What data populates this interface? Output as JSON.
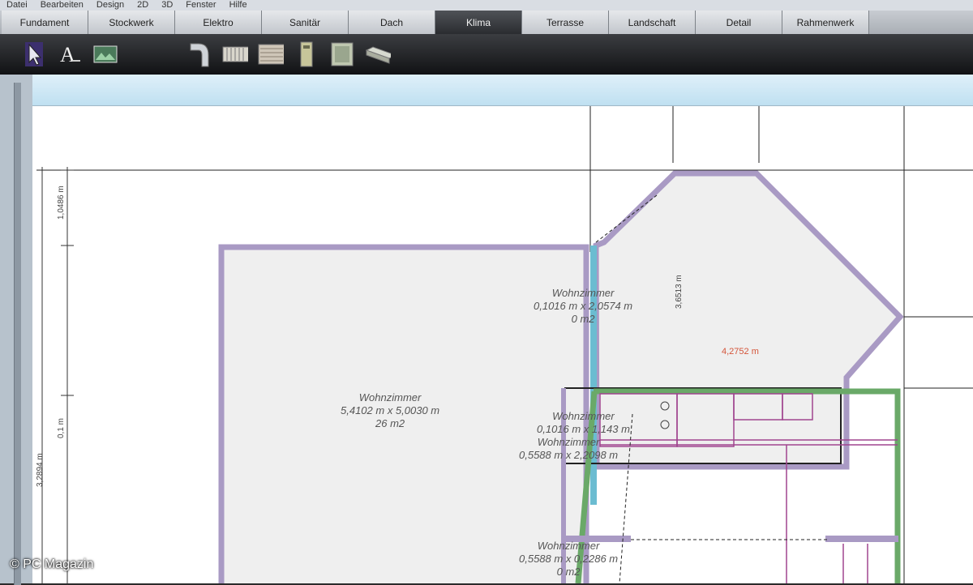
{
  "menu": [
    "Datei",
    "Bearbeiten",
    "Design",
    "2D",
    "3D",
    "Fenster",
    "Hilfe"
  ],
  "tabs": [
    {
      "label": "Fundament",
      "active": false
    },
    {
      "label": "Stockwerk",
      "active": false
    },
    {
      "label": "Elektro",
      "active": false
    },
    {
      "label": "Sanitär",
      "active": false
    },
    {
      "label": "Dach",
      "active": false
    },
    {
      "label": "Klima",
      "active": true
    },
    {
      "label": "Terrasse",
      "active": false
    },
    {
      "label": "Landschaft",
      "active": false
    },
    {
      "label": "Detail",
      "active": false
    },
    {
      "label": "Rahmenwerk",
      "active": false
    }
  ],
  "toolbar": {
    "tools": [
      "select-arrow-icon",
      "text-tool-icon",
      "image-tool-icon",
      "duct-elbow-icon",
      "radiator-icon",
      "vent-grille-icon",
      "boiler-icon",
      "ac-unit-icon",
      "duct-pipe-icon"
    ]
  },
  "plan": {
    "room1": {
      "name": "Wohnzimmer",
      "dims": "5,4102 m x 5,0030 m",
      "area": "26 m2"
    },
    "room2": {
      "name": "Wohnzimmer",
      "dims": "0,1016 m x 2,0574 m",
      "area": "0 m2"
    },
    "room3": {
      "name": "Wohnzimmer",
      "dims": "0,1016 m x 1,143 m"
    },
    "room4": {
      "name": "Wohnzimmer",
      "dims": "0,5588 m x 2,2098 m"
    },
    "room5": {
      "name": "Wohnzimmer",
      "dims": "0,5588 m x 0,2286 m",
      "area": "0 m2"
    },
    "dim_orange": "4,2752 m",
    "dim_diag": "3,6513 m",
    "dim_left_1": "1,0486 m",
    "dim_left_2": "3,2894 m",
    "dim_left_3": "0,1 m"
  },
  "colors": {
    "wall_purple": "#a99ac4",
    "wall_green": "#6aa968",
    "wall_cyan": "#6bbcd1",
    "fixture_magenta": "#a0458f",
    "active_tab": "#2f3135"
  },
  "watermark": "© PC Magazin"
}
